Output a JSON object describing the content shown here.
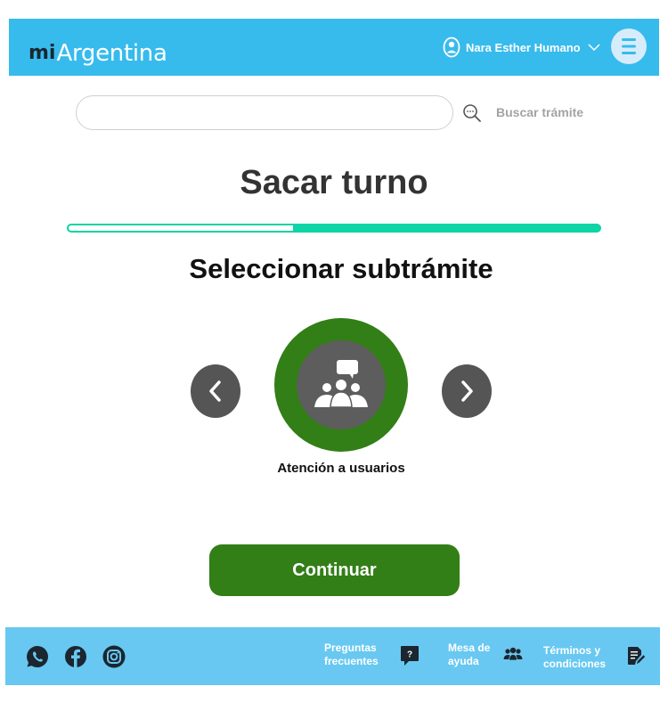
{
  "header": {
    "logo_mi": "mi",
    "logo_name": "Argentina",
    "user_name": "Nara Esther Humano"
  },
  "search": {
    "placeholder": "",
    "label": "Buscar trámite"
  },
  "page": {
    "title": "Sacar turno",
    "progress": 0.42,
    "subtitle": "Seleccionar subtrámite"
  },
  "carousel": {
    "selected_option": "Atención a usuarios",
    "option_icon": "group-chat-icon"
  },
  "actions": {
    "continue_label": "Continuar"
  },
  "footer": {
    "social": [
      "whatsapp-icon",
      "facebook-icon",
      "instagram-icon"
    ],
    "faq_label": "Preguntas frecuentes",
    "help_label": "Mesa de ayuda",
    "terms_label": "Términos y condiciones"
  },
  "colors": {
    "header_bg": "#37bbed",
    "footer_bg": "#68c8f1",
    "progress": "#0ed4a6",
    "primary_green": "#327e17",
    "nav_gray": "#555555"
  }
}
